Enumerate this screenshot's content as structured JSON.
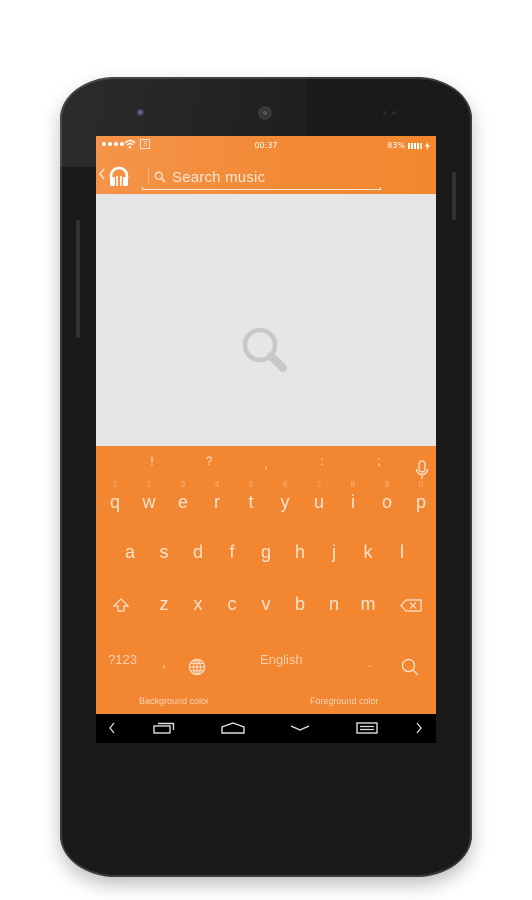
{
  "status_bar": {
    "signal_dots": 4,
    "carrier_badge": "3",
    "time": "00:37",
    "battery_percent": "83%",
    "battery_level": 0.8,
    "charging": true
  },
  "app_bar": {
    "back_icon": "chevron-left-icon",
    "app_icon": "headphones-icon",
    "search": {
      "icon": "search-icon",
      "placeholder": "Search music",
      "value": ""
    }
  },
  "results": {
    "empty_state_icon": "search-icon"
  },
  "keyboard": {
    "symbol_row": [
      "!",
      "?",
      ",",
      ":",
      ";"
    ],
    "mic_icon": "microphone-icon",
    "row1": [
      {
        "hint": "1",
        "key": "q"
      },
      {
        "hint": "2",
        "key": "w"
      },
      {
        "hint": "3",
        "key": "e"
      },
      {
        "hint": "4",
        "key": "r"
      },
      {
        "hint": "5",
        "key": "t"
      },
      {
        "hint": "6",
        "key": "y"
      },
      {
        "hint": "7",
        "key": "u"
      },
      {
        "hint": "8",
        "key": "i"
      },
      {
        "hint": "9",
        "key": "o"
      },
      {
        "hint": "0",
        "key": "p"
      }
    ],
    "row2": [
      "a",
      "s",
      "d",
      "f",
      "g",
      "h",
      "j",
      "k",
      "l"
    ],
    "row3": [
      "z",
      "x",
      "c",
      "v",
      "b",
      "n",
      "m"
    ],
    "shift_icon": "shift-icon",
    "backspace_icon": "backspace-icon",
    "bottom": {
      "symbols_label": "?123",
      "comma": ",",
      "globe_icon": "globe-icon",
      "space_label": "English",
      "period": ".",
      "search_icon": "search-icon"
    },
    "theme": {
      "background_color_label": "Background color",
      "foreground_color_label": "Foreground color",
      "background": "#f28631",
      "foreground": "#fde4d0"
    }
  },
  "nav_bar": {
    "buttons": [
      "chevron-left-icon",
      "recents-icon",
      "home-icon",
      "hide-keyboard-icon",
      "menu-icon",
      "chevron-right-icon"
    ]
  },
  "colors": {
    "accent": "#f28631",
    "content_bg": "#e6e6e6",
    "phone_body": "#1a1a1a"
  }
}
